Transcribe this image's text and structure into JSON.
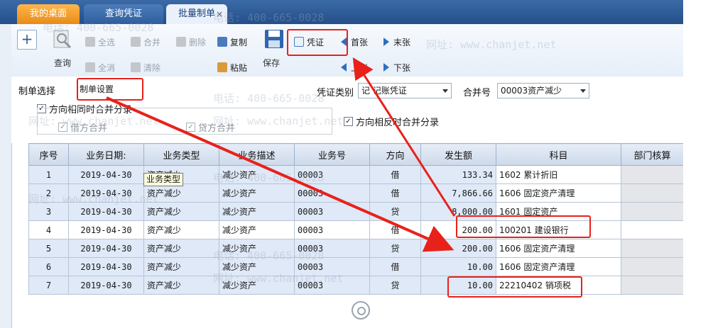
{
  "tabs": [
    {
      "label": "我的桌面"
    },
    {
      "label": "查询凭证"
    },
    {
      "label": "批量制单"
    }
  ],
  "tab_close_glyph": "×",
  "toolbar": {
    "query": "查询",
    "select_all": "全选",
    "deselect_all": "全消",
    "merge": "合并",
    "clear": "清除",
    "delete": "删除",
    "copy": "复制",
    "paste": "粘贴",
    "save": "保存",
    "voucher": "凭证",
    "first": "首张",
    "last": "末张",
    "prev": "上张",
    "next": "下张"
  },
  "form": {
    "make_select_label": "制单选择",
    "make_settings_value": "制单设置",
    "voucher_type_label": "凭证类别",
    "voucher_type_value": "记 记账凭证",
    "merge_no_label": "合并号",
    "merge_no_value": "00003资产减少",
    "same_dir_merge": "方向相同时合并分录",
    "debit_merge": "借方合并",
    "credit_merge": "贷方合并",
    "opposite_dir_merge": "方向相反时合并分录",
    "check_mark": "✓"
  },
  "table": {
    "headers": [
      "序号",
      "业务日期:",
      "业务类型",
      "业务描述",
      "业务号",
      "方向",
      "发生额",
      "科目",
      "部门核算"
    ],
    "rows": [
      {
        "no": "1",
        "date": "2019-04-30",
        "type": "资产减少",
        "desc": "减少资产",
        "bizno": "00003",
        "dir": "借",
        "amount": "133.34",
        "subject": "1602  累计折旧"
      },
      {
        "no": "2",
        "date": "2019-04-30",
        "type": "资产减少",
        "desc": "减少资产",
        "bizno": "00003",
        "dir": "借",
        "amount": "7,866.66",
        "subject": "1606  固定资产清理"
      },
      {
        "no": "3",
        "date": "2019-04-30",
        "type": "资产减少",
        "desc": "减少资产",
        "bizno": "00003",
        "dir": "贷",
        "amount": "8,000.00",
        "subject": "1601  固定资产"
      },
      {
        "no": "4",
        "date": "2019-04-30",
        "type": "资产减少",
        "desc": "减少资产",
        "bizno": "00003",
        "dir": "借",
        "amount": "200.00",
        "subject": "100201   建设银行"
      },
      {
        "no": "5",
        "date": "2019-04-30",
        "type": "资产减少",
        "desc": "减少资产",
        "bizno": "00003",
        "dir": "贷",
        "amount": "200.00",
        "subject": "1606  固定资产清理"
      },
      {
        "no": "6",
        "date": "2019-04-30",
        "type": "资产减少",
        "desc": "减少资产",
        "bizno": "00003",
        "dir": "借",
        "amount": "10.00",
        "subject": "1606  固定资产清理"
      },
      {
        "no": "7",
        "date": "2019-04-30",
        "type": "资产减少",
        "desc": "减少资产",
        "bizno": "00003",
        "dir": "贷",
        "amount": "10.00",
        "subject": "22210402  销项税"
      }
    ]
  },
  "tooltip": "业务类型",
  "watermark": {
    "phone": "电话: 400-665-0028",
    "site": "网址: www.chanjet.net"
  },
  "colors": {
    "annotation": "#e8211b",
    "tab_active_home": "#f0a030"
  }
}
